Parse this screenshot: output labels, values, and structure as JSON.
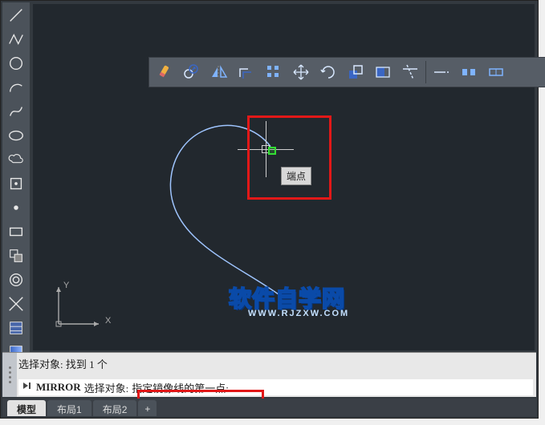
{
  "snap": {
    "tooltip": "端点"
  },
  "watermark": {
    "title": "软件自学网",
    "url": "WWW.RJZXW.COM"
  },
  "ucs": {
    "x": "X",
    "y": "Y"
  },
  "command": {
    "history": "选择对象: 找到 1 个",
    "prompt_cmd": "MIRROR",
    "prompt_sel": "选择对象:",
    "prompt_text": "指定镜像线的第一点:",
    "placeholder": ""
  },
  "tabs": {
    "model": "模型",
    "layout1": "布局1",
    "layout2": "布局2",
    "plus": "+"
  },
  "left_tools": [
    "line-tool",
    "polyline-tool",
    "circle-tool",
    "arc-tool",
    "rect-tool",
    "ellipse-tool",
    "hatch-left-tool",
    "point-tool",
    "block-tool",
    "rectangle2-tool",
    "region-tool",
    "line2-tool",
    "gradient-tool",
    "solid-tool",
    "donut-tool"
  ],
  "ribbon_tools": [
    "erase-tool",
    "copy-tool",
    "mirror-tool",
    "offset-tool",
    "array-tool",
    "move-tool",
    "rotate-tool",
    "scale-tool",
    "stretch-tool",
    "trim-tool",
    "extend-tool",
    "break-tool",
    "join-tool"
  ],
  "colors": {
    "accent_red": "#e21818",
    "snap_green": "#33de33",
    "bg_canvas": "#22282e"
  }
}
